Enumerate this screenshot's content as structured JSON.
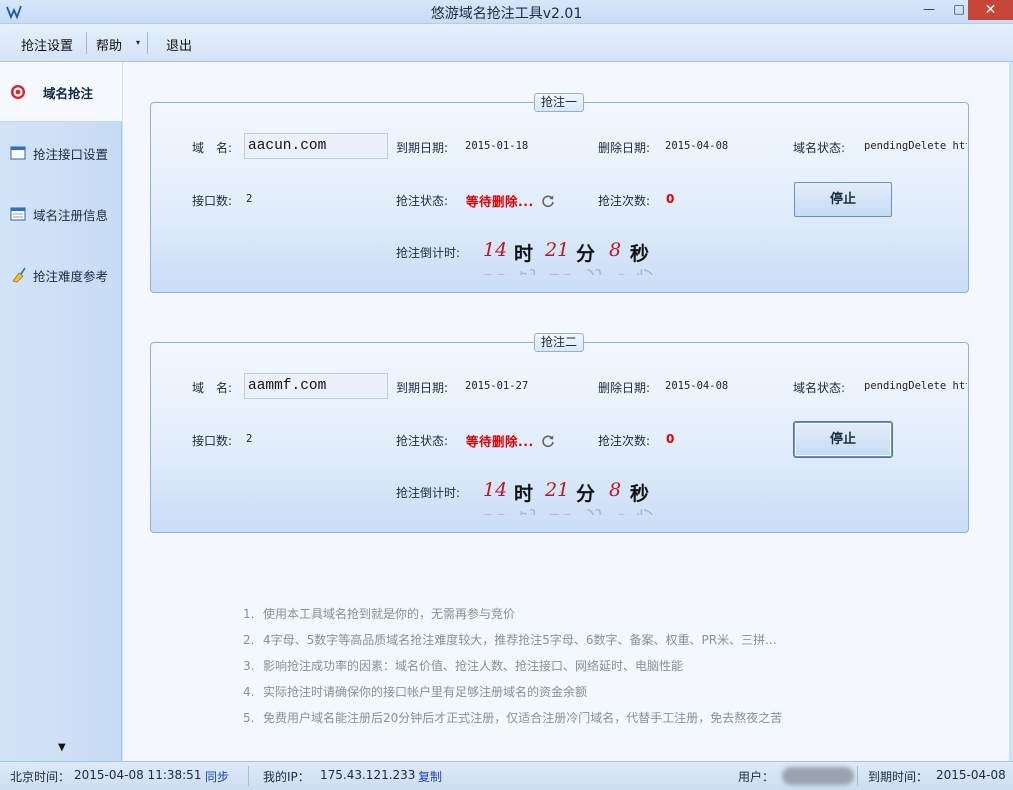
{
  "window": {
    "title": "悠游域名抢注工具v2.01",
    "minimize": "—",
    "maximize": "□",
    "close": "✕"
  },
  "menu": {
    "settings": "抢注设置",
    "help": "帮助",
    "help_arrow": "▾",
    "exit": "退出"
  },
  "sidebar": {
    "items": [
      {
        "label": "域名抢注",
        "icon": "target-icon"
      },
      {
        "label": "抢注接口设置",
        "icon": "window-icon"
      },
      {
        "label": "域名注册信息",
        "icon": "form-window-icon"
      },
      {
        "label": "抢注难度参考",
        "icon": "broom-icon"
      }
    ],
    "scroll_down": "▼"
  },
  "panels": [
    {
      "legend": "抢注一",
      "domain_label": "域　名:",
      "domain_value": "aacun.com",
      "expire_label": "到期日期:",
      "expire_value": "2015-01-18",
      "delete_label": "删除日期:",
      "delete_value": "2015-04-08",
      "status_label": "域名状态:",
      "status_value": "pendingDelete htt",
      "iface_label": "接口数:",
      "iface_value": "2",
      "grab_state_label": "抢注状态:",
      "grab_state_value": "等待删除...",
      "attempts_label": "抢注次数:",
      "attempts_value": "0",
      "stop_label": "停止",
      "countdown_label": "抢注倒计时:",
      "hours": "14",
      "hours_unit": "时",
      "minutes": "21",
      "minutes_unit": "分",
      "seconds": "8",
      "seconds_unit": "秒"
    },
    {
      "legend": "抢注二",
      "domain_label": "域　名:",
      "domain_value": "aammf.com",
      "expire_label": "到期日期:",
      "expire_value": "2015-01-27",
      "delete_label": "删除日期:",
      "delete_value": "2015-04-08",
      "status_label": "域名状态:",
      "status_value": "pendingDelete htt",
      "iface_label": "接口数:",
      "iface_value": "2",
      "grab_state_label": "抢注状态:",
      "grab_state_value": "等待删除...",
      "attempts_label": "抢注次数:",
      "attempts_value": "0",
      "stop_label": "停止",
      "countdown_label": "抢注倒计时:",
      "hours": "14",
      "hours_unit": "时",
      "minutes": "21",
      "minutes_unit": "分",
      "seconds": "8",
      "seconds_unit": "秒"
    }
  ],
  "tips": [
    {
      "num": "1.",
      "text": "使用本工具域名抢到就是你的，无需再参与竞价"
    },
    {
      "num": "2.",
      "text": "4字母、5数字等高品质域名抢注难度较大，推荐抢注5字母、6数字、备案、权重、PR米、三拼..."
    },
    {
      "num": "3.",
      "text": "影响抢注成功率的因素：域名价值、抢注人数、抢注接口、网络延时、电脑性能"
    },
    {
      "num": "4.",
      "text": "实际抢注时请确保你的接口帐户里有足够注册域名的资金余额"
    },
    {
      "num": "5.",
      "text": "免费用户域名能注册后20分钟后才正式注册，仅适合注册冷门域名，代替手工注册，免去熬夜之苦"
    }
  ],
  "statusbar": {
    "bj_time_label": "北京时间：",
    "bj_time_value": "2015-04-08 11:38:51",
    "sync_link": "同步",
    "ip_label": "我的IP：",
    "ip_value": "175.43.121.233",
    "copy_link": "复制",
    "user_label": "用户：",
    "expiry_label": "到期时间：",
    "expiry_value": "2015-04-08"
  },
  "colors": {
    "accent_red": "#e00000",
    "countdown_red": "#c0141c",
    "link_blue": "#1a46b8",
    "close_red": "#c7463a"
  }
}
